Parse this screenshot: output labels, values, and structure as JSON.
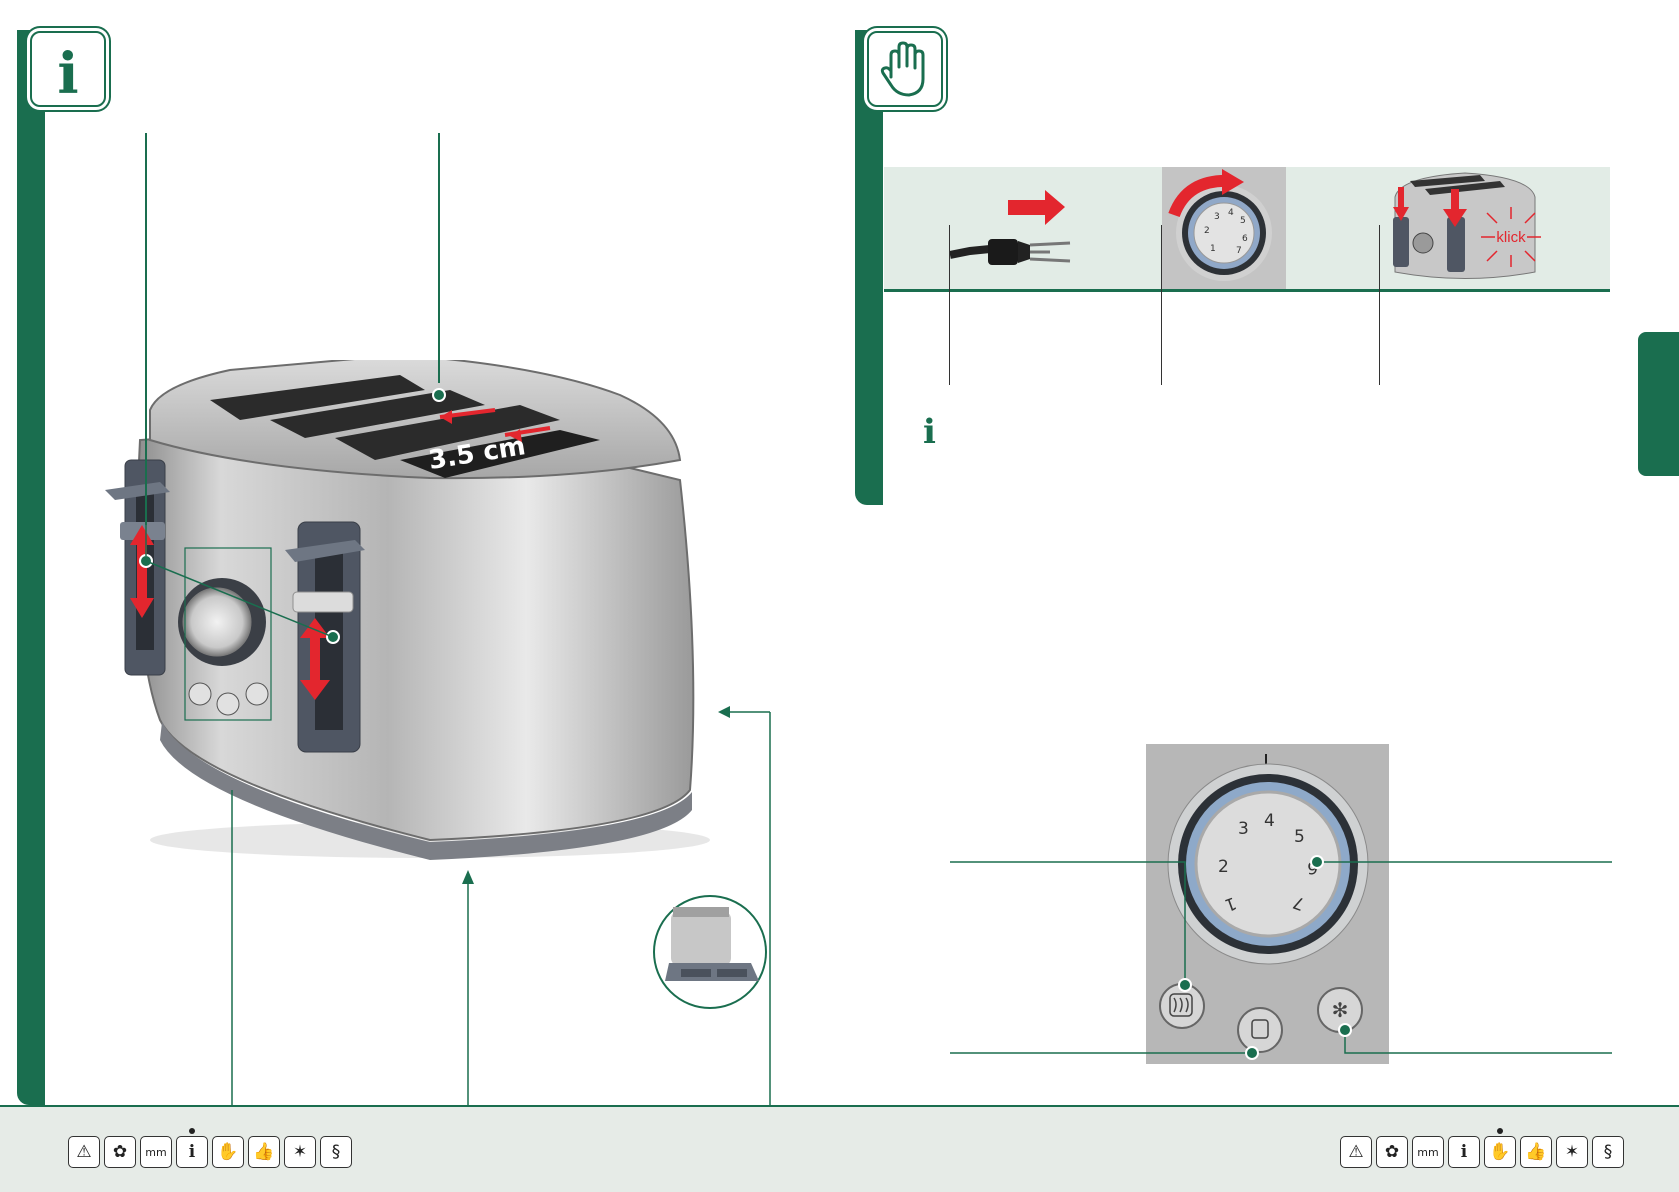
{
  "left_header": {
    "icon": "info-icon",
    "glyph": "i"
  },
  "right_header": {
    "icon": "hand-icon"
  },
  "toaster": {
    "slot_gauge_text": "3.5 cm",
    "dial_numbers": [
      "1",
      "2",
      "3",
      "4",
      "5",
      "6",
      "7"
    ]
  },
  "steps": {
    "step3_text": "klick",
    "note_icon": "i"
  },
  "control_panel": {
    "dial_numbers": [
      "1",
      "2",
      "3",
      "4",
      "5",
      "6",
      "7"
    ]
  },
  "footer": {
    "left_icons": [
      {
        "name": "warning-icon",
        "glyph": "⚠",
        "active": false
      },
      {
        "name": "eco-flower-icon",
        "glyph": "✿",
        "active": false
      },
      {
        "name": "ruler-mm-icon",
        "glyph": "mm",
        "active": false
      },
      {
        "name": "info-icon",
        "glyph": "i",
        "active": true
      },
      {
        "name": "hand-icon",
        "glyph": "✋",
        "active": false
      },
      {
        "name": "thumbs-up-icon",
        "glyph": "👍",
        "active": false
      },
      {
        "name": "asterisk-icon",
        "glyph": "✶",
        "active": false
      },
      {
        "name": "paragraph-icon",
        "glyph": "§",
        "active": false
      }
    ],
    "right_icons": [
      {
        "name": "warning-icon",
        "glyph": "⚠",
        "active": false
      },
      {
        "name": "eco-flower-icon",
        "glyph": "✿",
        "active": false
      },
      {
        "name": "ruler-mm-icon",
        "glyph": "mm",
        "active": false
      },
      {
        "name": "info-icon",
        "glyph": "i",
        "active": false
      },
      {
        "name": "hand-icon",
        "glyph": "✋",
        "active": true
      },
      {
        "name": "thumbs-up-icon",
        "glyph": "👍",
        "active": false
      },
      {
        "name": "asterisk-icon",
        "glyph": "✶",
        "active": false
      },
      {
        "name": "paragraph-icon",
        "glyph": "§",
        "active": false
      }
    ]
  },
  "colors": {
    "brand_green": "#1a6e4f",
    "accent_red": "#e3262e",
    "panel_bg": "#e2ece6"
  }
}
